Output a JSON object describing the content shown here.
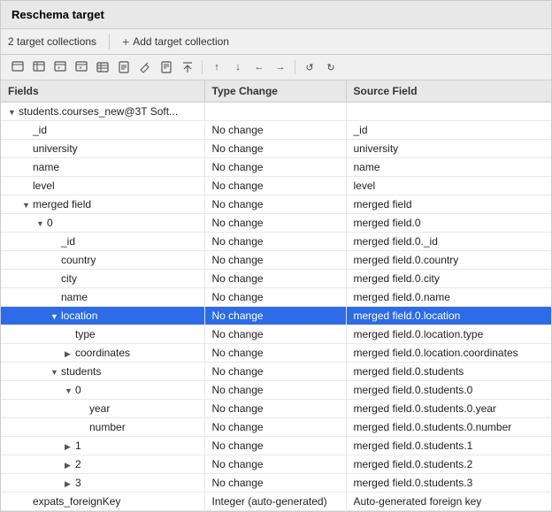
{
  "window": {
    "title": "Reschema target"
  },
  "toolbar": {
    "collection_count": "2 target collections",
    "add_label": "Add target collection"
  },
  "columns": {
    "fields": "Fields",
    "type_change": "Type Change",
    "source_field": "Source Field"
  },
  "rows": [
    {
      "id": "root",
      "indent": 0,
      "toggle": "expanded",
      "field": "students.courses_new@3T Soft...",
      "type": "",
      "source": "",
      "selected": false,
      "root": true
    },
    {
      "id": "r1",
      "indent": 1,
      "toggle": "leaf",
      "field": "_id",
      "type": "No change",
      "source": "_id",
      "selected": false
    },
    {
      "id": "r2",
      "indent": 1,
      "toggle": "leaf",
      "field": "university",
      "type": "No change",
      "source": "university",
      "selected": false
    },
    {
      "id": "r3",
      "indent": 1,
      "toggle": "leaf",
      "field": "name",
      "type": "No change",
      "source": "name",
      "selected": false
    },
    {
      "id": "r4",
      "indent": 1,
      "toggle": "leaf",
      "field": "level",
      "type": "No change",
      "source": "level",
      "selected": false
    },
    {
      "id": "r5",
      "indent": 1,
      "toggle": "expanded",
      "field": "merged field",
      "type": "No change",
      "source": "merged field",
      "selected": false
    },
    {
      "id": "r6",
      "indent": 2,
      "toggle": "expanded",
      "field": "0",
      "type": "No change",
      "source": "merged field.0",
      "selected": false
    },
    {
      "id": "r7",
      "indent": 3,
      "toggle": "leaf",
      "field": "_id",
      "type": "No change",
      "source": "merged field.0._id",
      "selected": false
    },
    {
      "id": "r8",
      "indent": 3,
      "toggle": "leaf",
      "field": "country",
      "type": "No change",
      "source": "merged field.0.country",
      "selected": false
    },
    {
      "id": "r9",
      "indent": 3,
      "toggle": "leaf",
      "field": "city",
      "type": "No change",
      "source": "merged field.0.city",
      "selected": false
    },
    {
      "id": "r10",
      "indent": 3,
      "toggle": "leaf",
      "field": "name",
      "type": "No change",
      "source": "merged field.0.name",
      "selected": false
    },
    {
      "id": "r11",
      "indent": 3,
      "toggle": "expanded",
      "field": "location",
      "type": "No change",
      "source": "merged field.0.location",
      "selected": true
    },
    {
      "id": "r12",
      "indent": 4,
      "toggle": "leaf",
      "field": "type",
      "type": "No change",
      "source": "merged field.0.location.type",
      "selected": false
    },
    {
      "id": "r13",
      "indent": 4,
      "toggle": "collapsed",
      "field": "coordinates",
      "type": "No change",
      "source": "merged field.0.location.coordinates",
      "selected": false
    },
    {
      "id": "r14",
      "indent": 3,
      "toggle": "expanded",
      "field": "students",
      "type": "No change",
      "source": "merged field.0.students",
      "selected": false
    },
    {
      "id": "r15",
      "indent": 4,
      "toggle": "expanded",
      "field": "0",
      "type": "No change",
      "source": "merged field.0.students.0",
      "selected": false
    },
    {
      "id": "r16",
      "indent": 5,
      "toggle": "leaf",
      "field": "year",
      "type": "No change",
      "source": "merged field.0.students.0.year",
      "selected": false
    },
    {
      "id": "r17",
      "indent": 5,
      "toggle": "leaf",
      "field": "number",
      "type": "No change",
      "source": "merged field.0.students.0.number",
      "selected": false
    },
    {
      "id": "r18",
      "indent": 4,
      "toggle": "collapsed",
      "field": "1",
      "type": "No change",
      "source": "merged field.0.students.1",
      "selected": false
    },
    {
      "id": "r19",
      "indent": 4,
      "toggle": "collapsed",
      "field": "2",
      "type": "No change",
      "source": "merged field.0.students.2",
      "selected": false
    },
    {
      "id": "r20",
      "indent": 4,
      "toggle": "collapsed",
      "field": "3",
      "type": "No change",
      "source": "merged field.0.students.3",
      "selected": false
    },
    {
      "id": "r21",
      "indent": 1,
      "toggle": "leaf",
      "field": "expats_foreignKey",
      "type": "Integer (auto-generated)",
      "source": "Auto-generated foreign key",
      "selected": false
    }
  ],
  "icons": {
    "add": "+",
    "arrow_up": "↑",
    "arrow_down": "↓",
    "arrow_left": "←",
    "arrow_right": "→",
    "undo": "↺",
    "redo": "↻"
  }
}
